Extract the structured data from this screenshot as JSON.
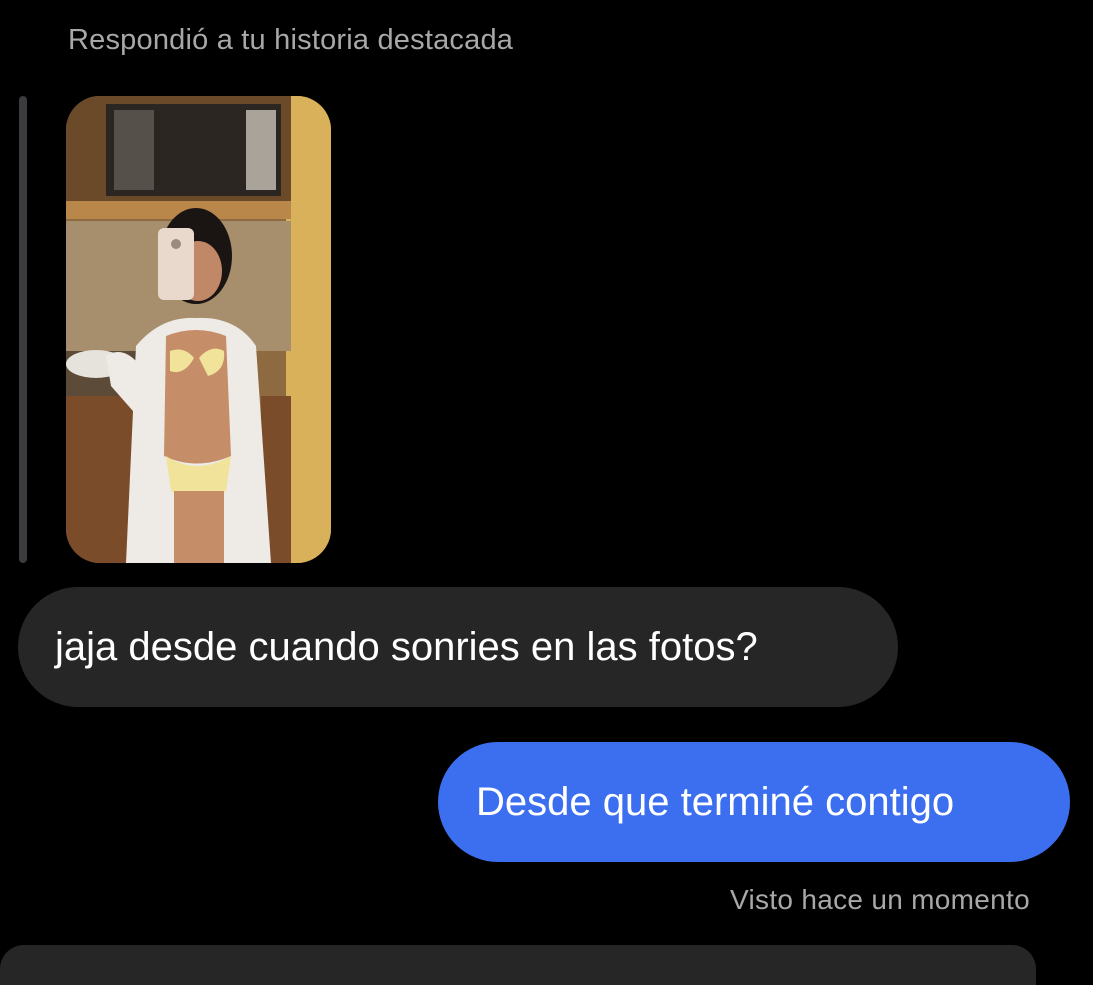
{
  "thread": {
    "reply_context": "Respondió a tu historia destacada",
    "story_preview": {
      "alt": "story-photo"
    },
    "messages": [
      {
        "direction": "incoming",
        "text": "jaja desde cuando sonries en las fotos?"
      },
      {
        "direction": "outgoing",
        "text": "Desde que terminé contigo"
      }
    ],
    "seen_status": "Visto hace un momento"
  },
  "colors": {
    "background": "#000000",
    "incoming_bubble": "#262626",
    "outgoing_bubble": "#3c6ff0",
    "secondary_text": "#a8a8a8"
  }
}
